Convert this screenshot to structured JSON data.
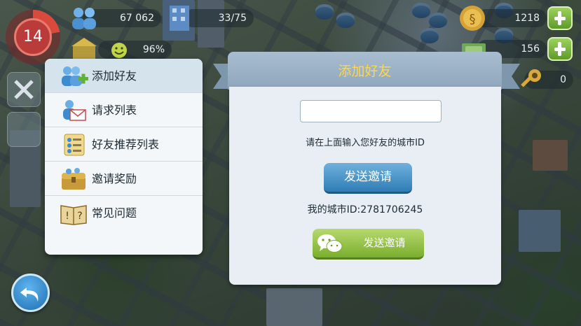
{
  "hud": {
    "level": "14",
    "population": "67 062",
    "capacity": "33/75",
    "happiness": "96%",
    "simoleons": "1218",
    "simcash": "156",
    "golden_keys": "0"
  },
  "menu": {
    "items": [
      {
        "label": "添加好友",
        "icon": "add-friend-icon",
        "active": true
      },
      {
        "label": "请求列表",
        "icon": "request-mail-icon",
        "active": false
      },
      {
        "label": "好友推荐列表",
        "icon": "recommended-friends-icon",
        "active": false
      },
      {
        "label": "邀请奖励",
        "icon": "reward-chest-icon",
        "active": false
      },
      {
        "label": "常见问题",
        "icon": "faq-book-icon",
        "active": false
      }
    ]
  },
  "dialog": {
    "title": "添加好友",
    "input_value": "",
    "hint": "请在上面输入您好友的城市ID",
    "send_label": "发送邀请",
    "my_city_id": "我的城市ID:2781706245",
    "wechat_label": "发送邀请"
  },
  "colors": {
    "title_yellow": "#ffd64a",
    "send_blue": "#2f7db5",
    "wechat_green": "#7aae2d"
  }
}
